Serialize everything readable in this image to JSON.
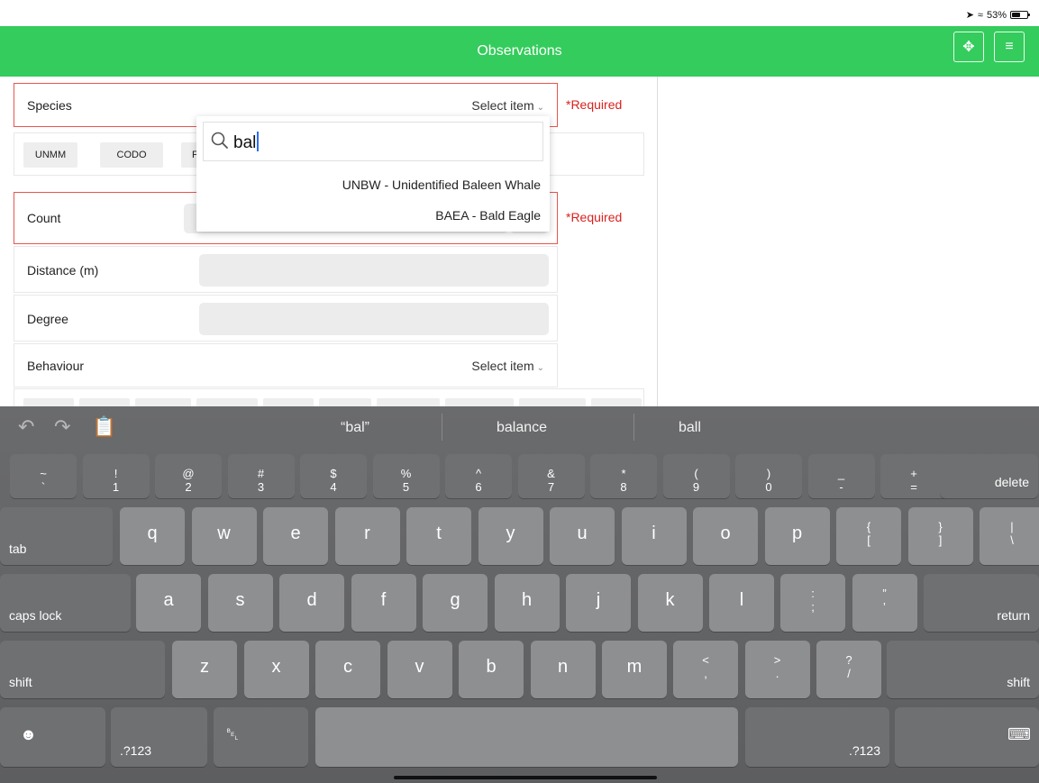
{
  "status": {
    "battery": "53%"
  },
  "nav": {
    "title": "Observations",
    "move_icon": "move-icon",
    "menu_icon": "hamburger-icon"
  },
  "form": {
    "species": {
      "label": "Species",
      "select": "Select item",
      "required": "*Required"
    },
    "species_chips": [
      "UNMM",
      "CODO",
      "F"
    ],
    "count": {
      "label": "Count",
      "required": "*Required"
    },
    "distance": {
      "label": "Distance (m)"
    },
    "degree": {
      "label": "Degree"
    },
    "behaviour": {
      "label": "Behaviour",
      "select": "Select item"
    }
  },
  "dropdown": {
    "query": "bal",
    "results": [
      "UNBW - Unidentified Baleen Whale",
      "BAEA - Bald Eagle"
    ]
  },
  "keyboard": {
    "suggestions": [
      "“bal”",
      "balance",
      "ball"
    ],
    "number_row": [
      {
        "top": "~",
        "bottom": "`"
      },
      {
        "top": "!",
        "bottom": "1"
      },
      {
        "top": "@",
        "bottom": "2"
      },
      {
        "top": "#",
        "bottom": "3"
      },
      {
        "top": "$",
        "bottom": "4"
      },
      {
        "top": "%",
        "bottom": "5"
      },
      {
        "top": "^",
        "bottom": "6"
      },
      {
        "top": "&",
        "bottom": "7"
      },
      {
        "top": "*",
        "bottom": "8"
      },
      {
        "top": "(",
        "bottom": "9"
      },
      {
        "top": ")",
        "bottom": "0"
      },
      {
        "top": "_",
        "bottom": "-"
      },
      {
        "top": "+",
        "bottom": "="
      }
    ],
    "delete": "delete",
    "tab": "tab",
    "row_q": [
      "q",
      "w",
      "e",
      "r",
      "t",
      "y",
      "u",
      "i",
      "o",
      "p"
    ],
    "row_q_extra": [
      {
        "top": "{",
        "bottom": "["
      },
      {
        "top": "}",
        "bottom": "]"
      },
      {
        "top": "|",
        "bottom": "\\"
      }
    ],
    "caps": "caps lock",
    "row_a": [
      "a",
      "s",
      "d",
      "f",
      "g",
      "h",
      "j",
      "k",
      "l"
    ],
    "row_a_extra": [
      {
        "top": ":",
        "bottom": ";"
      },
      {
        "top": "”",
        "bottom": "’"
      }
    ],
    "return": "return",
    "shift": "shift",
    "row_z": [
      "z",
      "x",
      "c",
      "v",
      "b",
      "n",
      "m"
    ],
    "row_z_extra": [
      {
        "top": "<",
        "bottom": ","
      },
      {
        "top": ">",
        "bottom": "."
      },
      {
        "top": "?",
        "bottom": "/"
      }
    ],
    "numbers": ".?123",
    "emoji_icon": "emoji-icon",
    "mic_icon": "microphone-icon",
    "hide_icon": "keyboard-dismiss-icon"
  }
}
